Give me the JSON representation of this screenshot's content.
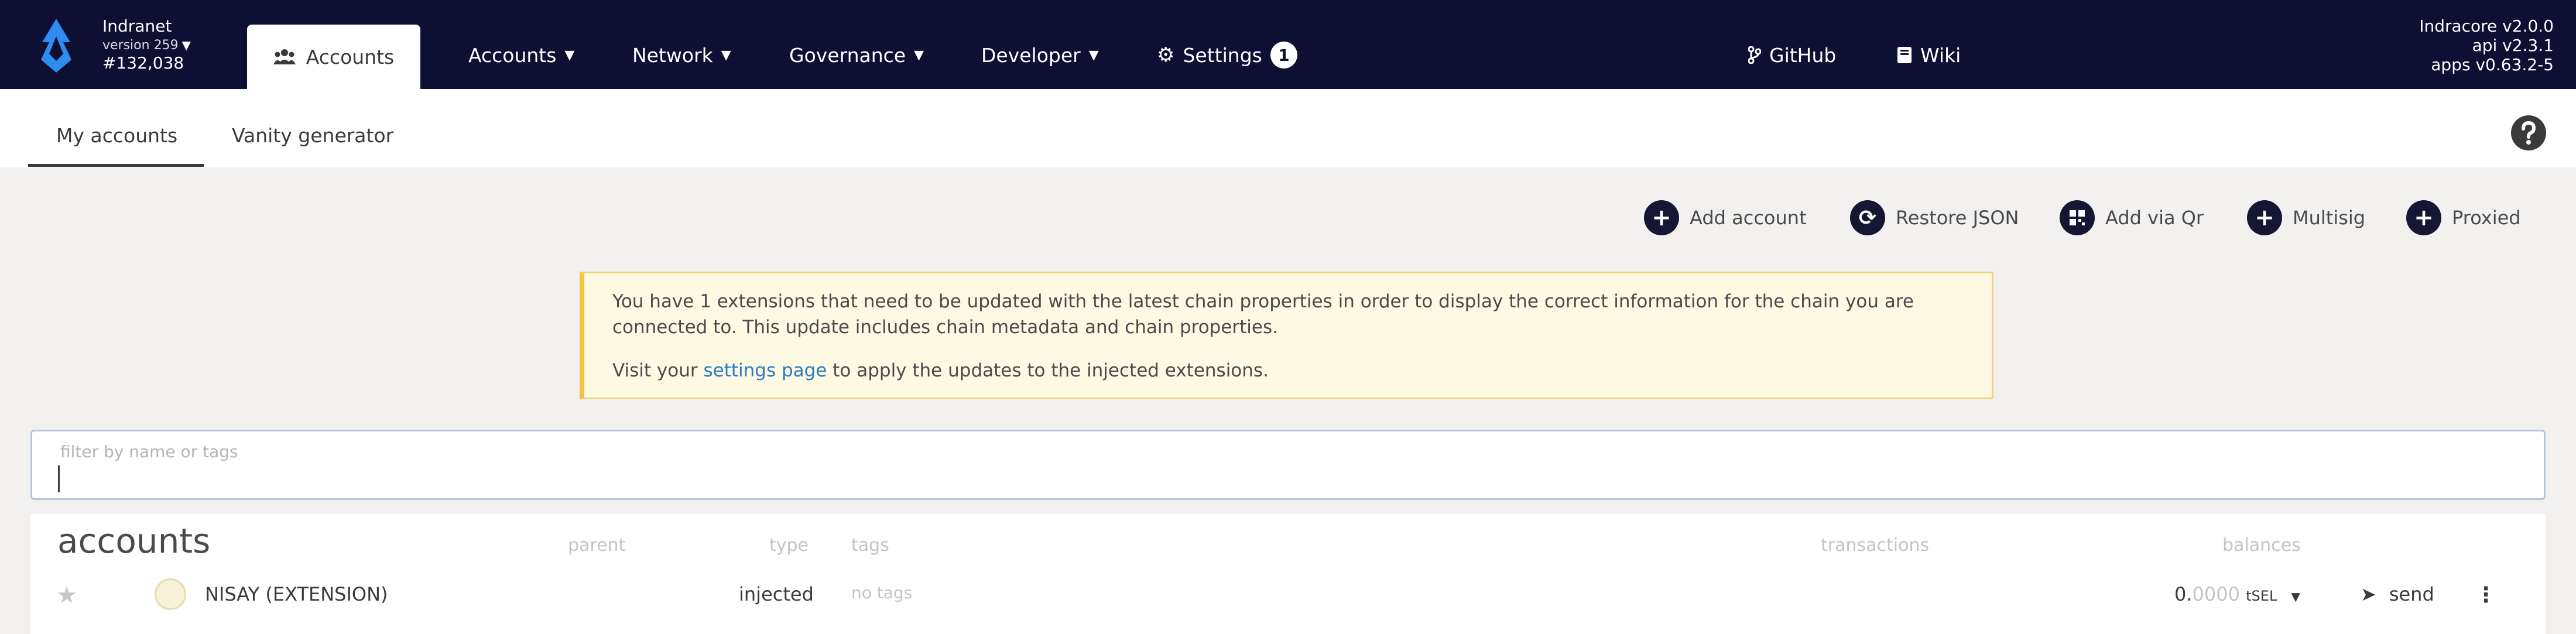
{
  "topbar": {
    "chain_name": "Indranet",
    "version": "version 259",
    "block": "#132,038",
    "active_tab": "Accounts",
    "nav": [
      {
        "label": "Accounts"
      },
      {
        "label": "Network"
      },
      {
        "label": "Governance"
      },
      {
        "label": "Developer"
      }
    ],
    "settings_label": "Settings",
    "settings_badge": "1",
    "github_label": "GitHub",
    "wiki_label": "Wiki",
    "versions": [
      "Indracore v2.0.0",
      "api v2.3.1",
      "apps v0.63.2-5"
    ]
  },
  "subnav": {
    "tabs": [
      "My accounts",
      "Vanity generator"
    ]
  },
  "actions": [
    {
      "label": "Add account",
      "icon": "plus-icon"
    },
    {
      "label": "Restore JSON",
      "icon": "sync-icon"
    },
    {
      "label": "Add via Qr",
      "icon": "qrcode-icon"
    },
    {
      "label": "Multisig",
      "icon": "plus-icon"
    },
    {
      "label": "Proxied",
      "icon": "plus-icon"
    }
  ],
  "warning": {
    "line1": "You have 1 extensions that need to be updated with the latest chain properties in order to display the correct information for the chain you are connected to. This update includes chain metadata and chain properties.",
    "line2_prefix": "Visit your ",
    "line2_link": "settings page",
    "line2_suffix": " to apply the updates to the injected extensions."
  },
  "filter": {
    "label": "filter by name or tags",
    "value": ""
  },
  "table": {
    "title": "accounts",
    "headers": {
      "parent": "parent",
      "type": "type",
      "tags": "tags",
      "transactions": "transactions",
      "balances": "balances"
    },
    "rows": [
      {
        "name": "NISAY (EXTENSION)",
        "type": "injected",
        "tags": "no tags",
        "balance_int": "0.",
        "balance_dec": "0000",
        "unit": "tSEL",
        "send": "send"
      }
    ]
  },
  "colors": {
    "topbar_bg": "#0d0f33",
    "warning_border": "#f5c242",
    "link": "#2b7bc6"
  }
}
